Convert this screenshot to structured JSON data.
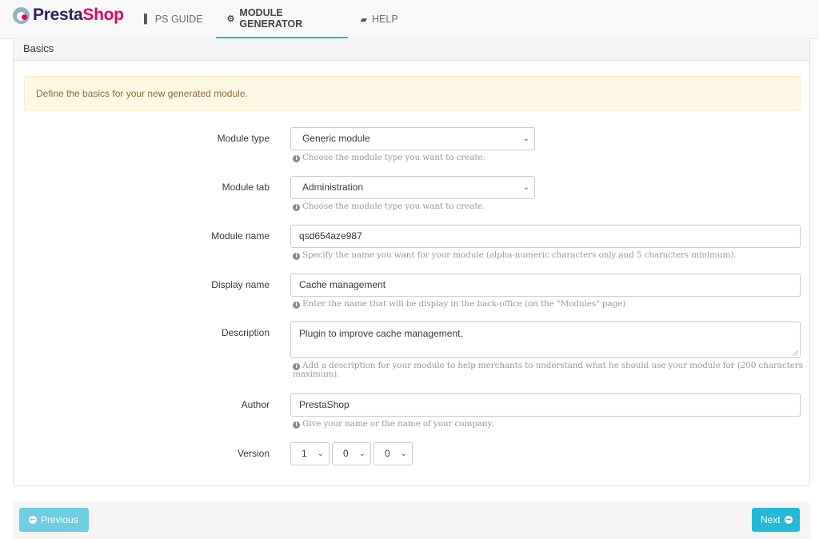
{
  "brand": {
    "part1": "Presta",
    "part2": "Shop"
  },
  "nav": [
    {
      "label": "PS GUIDE",
      "icon": "bookmark-icon",
      "glyph": "▌"
    },
    {
      "label": "MODULE GENERATOR",
      "icon": "cogs-icon",
      "glyph": "⚙"
    },
    {
      "label": "HELP",
      "icon": "book-icon",
      "glyph": "▰"
    }
  ],
  "panel": {
    "title": "Basics",
    "alert": "Define the basics for your new generated module."
  },
  "form": {
    "module_type": {
      "label": "Module type",
      "value": "Generic module",
      "help": "Choose the module type you want to create."
    },
    "module_tab": {
      "label": "Module tab",
      "value": "Administration",
      "help": "Choose the module type you want to create."
    },
    "module_name": {
      "label": "Module name",
      "value": "qsd654aze987",
      "help": "Specify the name you want for your module (alpha-numeric characters only and 5 characters minimum)."
    },
    "display_name": {
      "label": "Display name",
      "value": "Cache management",
      "help": "Enter the name that will be display in the back-office (on the \"Modules\" page)."
    },
    "description": {
      "label": "Description",
      "value": "Plugin to improve cache management.",
      "help": "Add a description for your module to help merchants to understand what he should use your module for (200 characters maximum)."
    },
    "author": {
      "label": "Author",
      "value": "PrestaShop",
      "help": "Give your name or the name of your company."
    },
    "version": {
      "label": "Version",
      "major": "1",
      "minor": "0",
      "patch": "0"
    }
  },
  "footer": {
    "previous_label": "Previous",
    "next_label": "Next"
  },
  "colors": {
    "accent": "#25b9d7",
    "accent_disabled": "#70cee2",
    "brand_dark": "#34205a",
    "brand_pink": "#df0067"
  }
}
